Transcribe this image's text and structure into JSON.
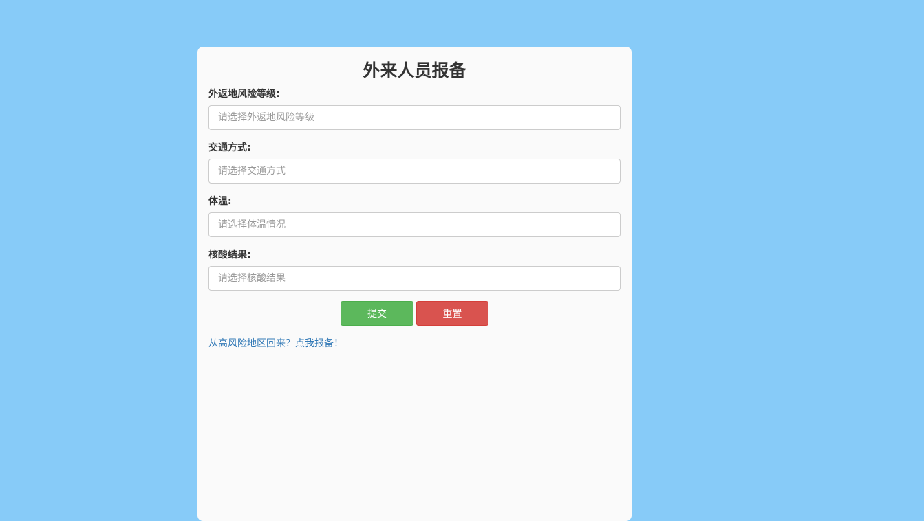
{
  "form": {
    "title": "外来人员报备",
    "fields": [
      {
        "label": "外返地风险等级:",
        "placeholder": "请选择外返地风险等级",
        "value": ""
      },
      {
        "label": "交通方式:",
        "placeholder": "请选择交通方式",
        "value": ""
      },
      {
        "label": "体温:",
        "placeholder": "请选择体温情况",
        "value": ""
      },
      {
        "label": "核酸结果:",
        "placeholder": "请选择核酸结果",
        "value": ""
      }
    ],
    "submit_label": "提交",
    "reset_label": "重置",
    "high_risk_link": "从高风险地区回来？点我报备！"
  },
  "colors": {
    "page_background": "#87cbf8",
    "card_background": "#fafafa",
    "submit_button": "#5cb85c",
    "reset_button": "#d9534f",
    "link": "#337ab7"
  }
}
